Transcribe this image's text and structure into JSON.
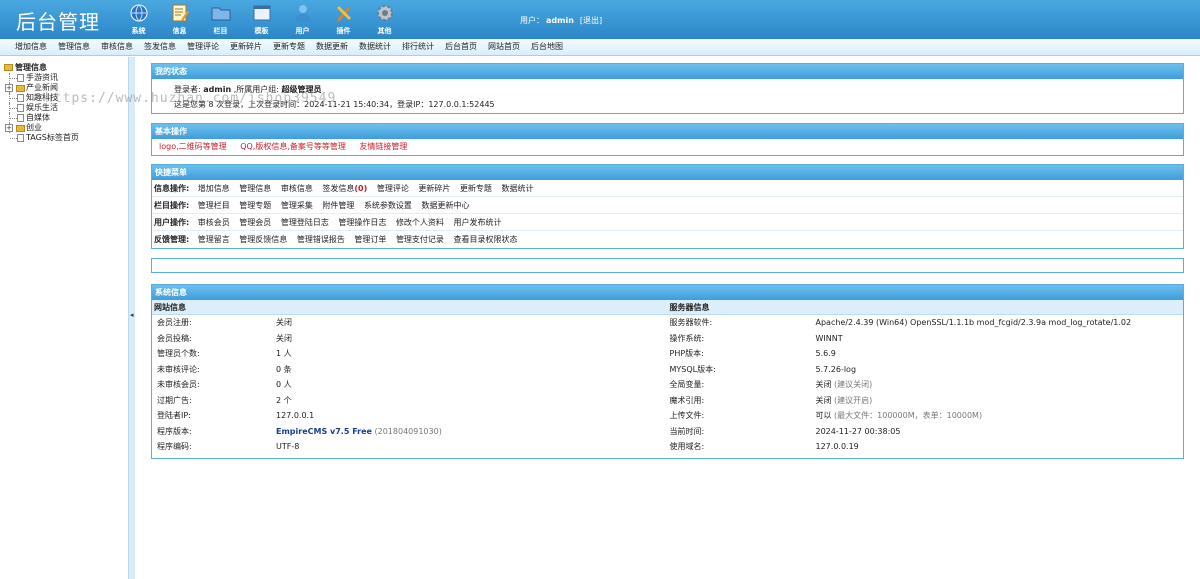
{
  "header": {
    "title": "后台管理",
    "nav": [
      {
        "label": "系统",
        "icon": "globe-icon"
      },
      {
        "label": "信息",
        "icon": "document-edit-icon"
      },
      {
        "label": "栏目",
        "icon": "folder-icon"
      },
      {
        "label": "模板",
        "icon": "window-icon"
      },
      {
        "label": "用户",
        "icon": "user-icon"
      },
      {
        "label": "插件",
        "icon": "tools-icon"
      },
      {
        "label": "其他",
        "icon": "gear-icon"
      }
    ],
    "user_label": "用户：",
    "username": "admin",
    "logout": "[退出]"
  },
  "subnav": [
    "增加信息",
    "管理信息",
    "审核信息",
    "签发信息",
    "管理评论",
    "更新碎片",
    "更新专题",
    "数据更新",
    "数据统计",
    "排行统计",
    "后台首页",
    "网站首页",
    "后台地图"
  ],
  "sidebar": {
    "root": "管理信息",
    "items": [
      "手游资讯",
      "产业新闻",
      "知趣科技",
      "娱乐生活",
      "自媒体",
      "创业",
      "TAGS标签首页"
    ]
  },
  "status": {
    "title": "我的状态",
    "login_user_label": "登录者:",
    "login_user": "admin",
    "group_label": ",所属用户组:",
    "group": "超级管理员",
    "line2": "这是您第 8 次登录，上次登录时间：2024-11-21 15:40:34，登录IP：127.0.0.1:52445",
    "watermark": "https://www.huzhan.com/ishop39549"
  },
  "basic": {
    "title": "基本操作",
    "links": [
      "logo,二维码等管理",
      "QQ,版权信息,备案号等等管理",
      "友情链接管理"
    ]
  },
  "quick": {
    "title": "快捷菜单",
    "rows": [
      {
        "label": "信息操作:",
        "links": [
          "增加信息",
          "管理信息",
          "审核信息",
          "签发信息"
        ],
        "count": "(0)",
        "links2": [
          "管理评论",
          "更新碎片",
          "更新专题",
          "数据统计"
        ]
      },
      {
        "label": "栏目操作:",
        "links": [
          "管理栏目",
          "管理专题",
          "管理采集",
          "附件管理",
          "系统参数设置",
          "数据更新中心"
        ]
      },
      {
        "label": "用户操作:",
        "links": [
          "审核会员",
          "管理会员",
          "管理登陆日志",
          "管理操作日志",
          "修改个人资料",
          "用户发布统计"
        ]
      },
      {
        "label": "反馈管理:",
        "links": [
          "管理留言",
          "管理反馈信息",
          "管理错误报告",
          "管理订单",
          "管理支付记录",
          "查看目录权限状态"
        ]
      }
    ]
  },
  "system": {
    "title": "系统信息",
    "site_head": "网站信息",
    "server_head": "服务器信息",
    "site": [
      {
        "k": "会员注册:",
        "v": "关闭"
      },
      {
        "k": "会员投稿:",
        "v": "关闭"
      },
      {
        "k": "管理员个数:",
        "v": "1 人"
      },
      {
        "k": "未审核评论:",
        "v": "0 条"
      },
      {
        "k": "未审核会员:",
        "v": "0 人"
      },
      {
        "k": "过期广告:",
        "v": "2 个"
      },
      {
        "k": "登陆者IP:",
        "v": "127.0.0.1"
      },
      {
        "k": "程序版本:",
        "v": "EmpireCMS v7.5 Free",
        "note": "(201804091030)"
      },
      {
        "k": "程序编码:",
        "v": "UTF-8"
      }
    ],
    "server": [
      {
        "k": "服务器软件:",
        "v": "Apache/2.4.39 (Win64) OpenSSL/1.1.1b mod_fcgid/2.3.9a mod_log_rotate/1.02"
      },
      {
        "k": "操作系统:",
        "v": "WINNT"
      },
      {
        "k": "PHP版本:",
        "v": "5.6.9"
      },
      {
        "k": "MYSQL版本:",
        "v": "5.7.26-log"
      },
      {
        "k": "全局变量:",
        "v": "关闭",
        "note": "(建议关闭)"
      },
      {
        "k": "魔术引用:",
        "v": "关闭",
        "note": "(建议开启)"
      },
      {
        "k": "上传文件:",
        "v": "可以",
        "note": "(最大文件：100000M，表单：10000M)"
      },
      {
        "k": "当前时间:",
        "v": "2024-11-27 00:38:05"
      },
      {
        "k": "使用域名:",
        "v": "127.0.0.19"
      }
    ]
  }
}
